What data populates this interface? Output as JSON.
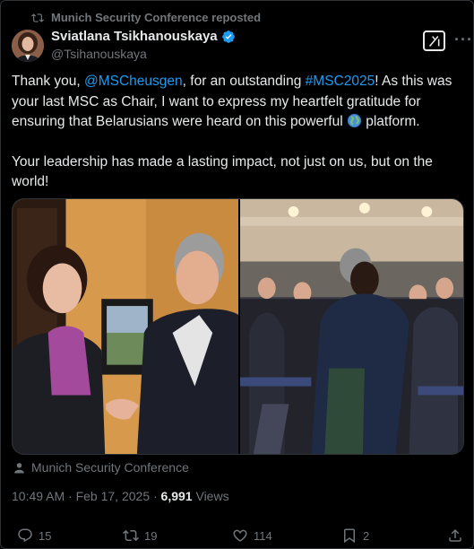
{
  "repost": {
    "label": "Munich Security Conference reposted",
    "icon": "repost-icon"
  },
  "author": {
    "name": "Sviatlana Tsikhanouskaya",
    "handle": "@Tsihanouskaya",
    "verified_icon": "verified-badge-icon"
  },
  "tweet": {
    "p1_a": "Thank you, ",
    "mention": "@MSCheusgen",
    "p1_b": ", for an outstanding ",
    "hashtag": "#MSC2025",
    "p1_c": "! As this was your last MSC as Chair, I want to express my heartfelt gratitude for ensuring that Belarusians were heard on this powerful ",
    "globe_icon": "globe-emoji-icon",
    "p1_d": " platform.",
    "p2": "Your leadership has made a lasting impact, not just on us, but on the world!"
  },
  "media": {
    "count": 2,
    "credit": "Munich Security Conference",
    "credit_icon": "person-icon"
  },
  "meta": {
    "time": "10:49 AM · Feb 17, 2025 · ",
    "views_count": "6,991",
    "views_label": " Views"
  },
  "actions": {
    "replies": "15",
    "reposts": "19",
    "likes": "114",
    "bookmarks": "2"
  },
  "colors": {
    "background": "#000000",
    "text": "#e7e9ea",
    "muted": "#71767b",
    "link": "#1d9bf0",
    "border": "#2f3336"
  }
}
